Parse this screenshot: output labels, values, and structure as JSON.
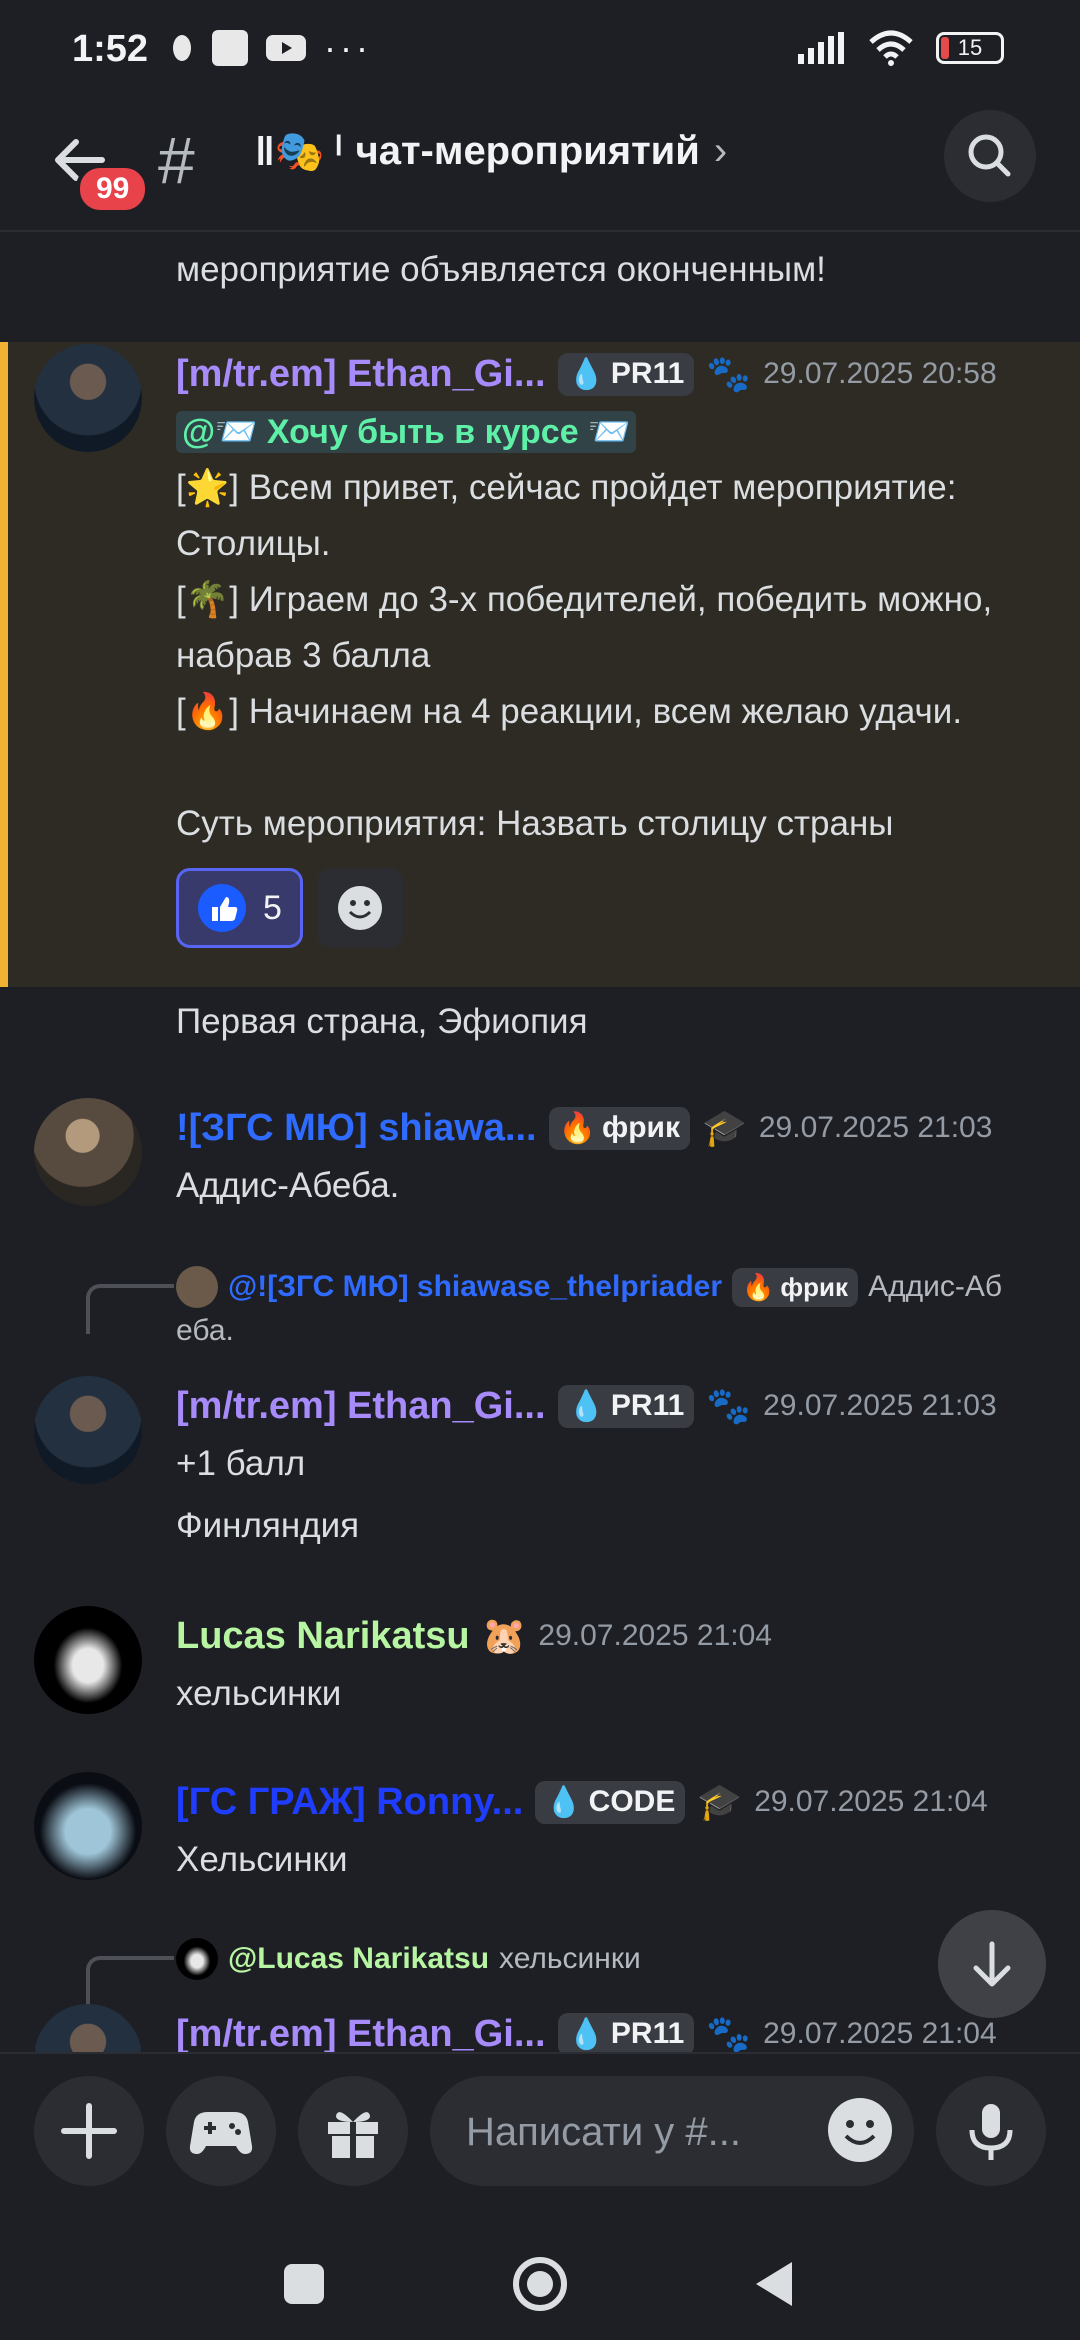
{
  "status_bar": {
    "time": "1:52",
    "dots": "···",
    "battery": "15"
  },
  "header": {
    "badge": "99",
    "hash": "#",
    "channel_prefix": "ǁ🎭 ˡ",
    "channel_name": "чат-мероприятий",
    "chevron": "›"
  },
  "feed": {
    "top_text": "мероприятие объявляется оконченным!",
    "messages": [
      {
        "username": "[m/tr.em] Ethan_Gi...",
        "tag": "PR11",
        "timestamp": "29.07.2025 20:58",
        "mention": "@📨 Хочу быть в курсе 📨",
        "lines": [
          "[🌟] Всем привет, сейчас пройдет мероприятие: Столицы.",
          "[🌴] Играем до 3-х победителей, победить можно, набрав 3 балла",
          "[🔥] Начинаем на 4 реакции, всем желаю удачи.",
          "Суть мероприятия: Назвать столицу страны"
        ],
        "reaction_count": "5"
      },
      {
        "text": "Первая страна, Эфиопия"
      },
      {
        "username": "![ЗГС МЮ] shiawa...",
        "tag": "фрик",
        "timestamp": "29.07.2025 21:03",
        "text": "Аддис-Абеба."
      },
      {
        "reply_user": "@![ЗГС МЮ] shiawase_thelpriader",
        "reply_tag": "фрик",
        "reply_text": "Аддис-Аб",
        "reply_text2": "еба.",
        "username": "[m/tr.em] Ethan_Gi...",
        "tag": "PR11",
        "timestamp": "29.07.2025 21:03",
        "text": "+1 балл",
        "text2": "Финляндия"
      },
      {
        "username": "Lucas Narikatsu",
        "timestamp": "29.07.2025 21:04",
        "text": "хельсинки"
      },
      {
        "username": "[ГС ГРАЖ] Ronny...",
        "tag": "CODE",
        "timestamp": "29.07.2025 21:04",
        "text": "Хельсинки"
      },
      {
        "reply_user": "@Lucas Narikatsu",
        "reply_text": "хельсинки",
        "username": "[m/tr.em] Ethan_Gi...",
        "tag": "PR11",
        "timestamp": "29.07.2025 21:04"
      }
    ]
  },
  "composer": {
    "placeholder": "Написати у #..."
  },
  "colors": {
    "accent": "#5865f2",
    "highlight_border": "#f0b232",
    "ethan": "#a78bfa",
    "shiawase": "#2f6bff",
    "lucas": "#b7f5a2",
    "ronny": "#1f3dff"
  },
  "icons": [
    "back-arrow-icon",
    "hash-icon",
    "search-icon",
    "thumbs-up-icon",
    "add-reaction-icon",
    "scroll-down-icon",
    "plus-icon",
    "gamepad-icon",
    "gift-icon",
    "emoji-icon",
    "microphone-icon",
    "recent-apps-icon",
    "home-icon",
    "back-icon"
  ]
}
